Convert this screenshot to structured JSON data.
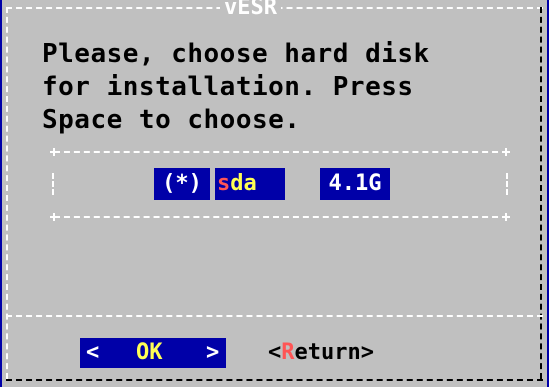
{
  "dialog": {
    "title": "vESR",
    "message": "Please, choose hard disk\nfor installation. Press\nSpace to choose."
  },
  "list": {
    "items": [
      {
        "marker": "(*)",
        "tag_hotkey": "s",
        "tag_rest": "da",
        "size": "4.1G",
        "selected": true
      }
    ]
  },
  "buttons": {
    "ok": {
      "left": "<",
      "label": "OK",
      "right": ">"
    },
    "return": {
      "open": "<",
      "hotkey": "R",
      "rest": "eturn",
      "close": ">"
    }
  },
  "colors": {
    "screen_bg": "#0000a8",
    "dialog_bg": "#c0c0c0",
    "highlight_bg": "#0000a8",
    "hotkey": "#ff5555",
    "accent_text": "#ffff55"
  }
}
